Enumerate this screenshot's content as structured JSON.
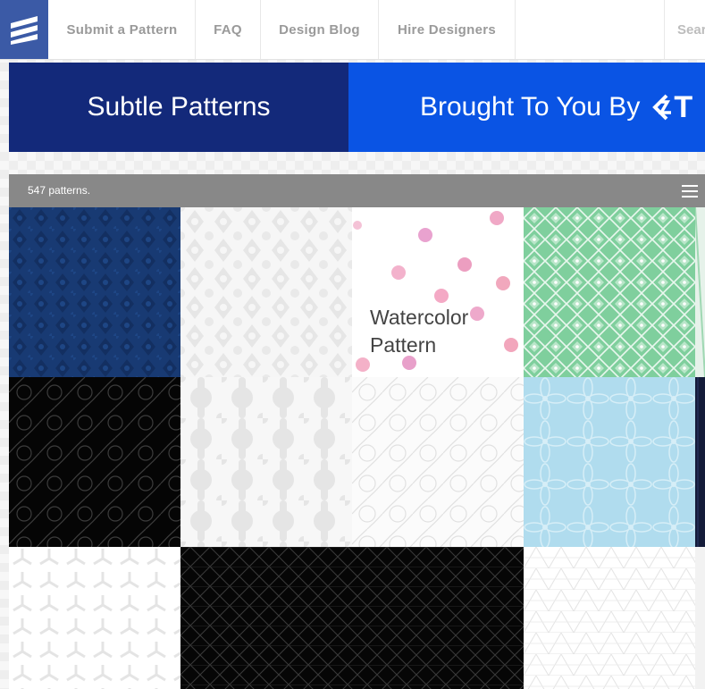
{
  "nav": {
    "items": [
      {
        "label": "Submit a Pattern"
      },
      {
        "label": "FAQ"
      },
      {
        "label": "Design Blog"
      },
      {
        "label": "Hire Designers"
      }
    ],
    "search_label": "Sear"
  },
  "banner": {
    "left_text": "Subtle Patterns",
    "right_text": "Brought To You By",
    "brand_partial": "T"
  },
  "toolbar": {
    "count_text": "547 patterns."
  },
  "tiles": {
    "featured_caption_line1": "Watercolor",
    "featured_caption_line2": "Pattern"
  },
  "colors": {
    "logo_bg": "#3b5aa6",
    "banner_left_bg": "#13297a",
    "banner_right_bg": "#0a54e4",
    "toolbar_bg": "#888888",
    "nav_text": "#9a9a9a"
  }
}
